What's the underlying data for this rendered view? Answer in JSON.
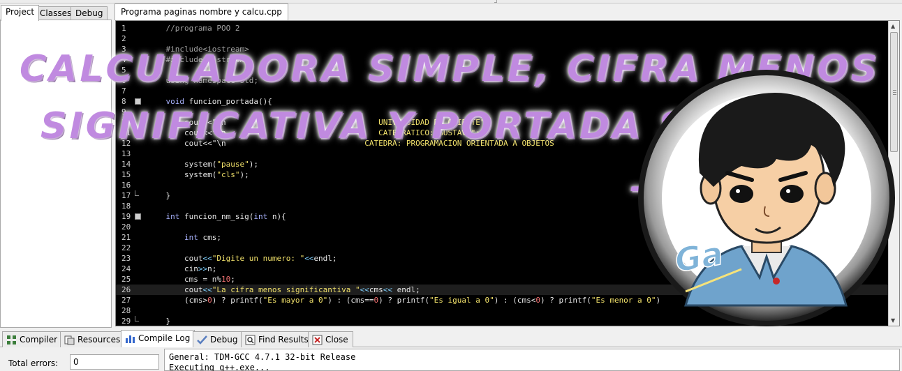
{
  "left_panel": {
    "tabs": [
      {
        "label": "Project",
        "active": true
      },
      {
        "label": "Classes",
        "active": false
      },
      {
        "label": "Debug",
        "active": false
      }
    ]
  },
  "editor": {
    "tab_label": "Programa paginas nombre y calcu.cpp",
    "lines": [
      {
        "n": "1",
        "segments": [
          {
            "t": "    //programa POO 2",
            "c": "comment"
          }
        ]
      },
      {
        "n": "2",
        "segments": []
      },
      {
        "n": "3",
        "segments": [
          {
            "t": "    #include<iostream>",
            "c": "comment"
          }
        ]
      },
      {
        "n": "4",
        "segments": [
          {
            "t": "    #include<iostream>",
            "c": "comment"
          }
        ]
      },
      {
        "n": "5",
        "segments": []
      },
      {
        "n": "6",
        "segments": [
          {
            "t": "    using namespace std;",
            "c": "comment"
          }
        ]
      },
      {
        "n": "7",
        "segments": []
      },
      {
        "n": "8",
        "fold": "box",
        "segments": [
          {
            "t": "    ",
            "c": ""
          },
          {
            "t": "void",
            "c": "kw"
          },
          {
            "t": " funcion_portada(){",
            "c": ""
          }
        ]
      },
      {
        "n": "9",
        "segments": []
      },
      {
        "n": "10",
        "segments": [
          {
            "t": "        cout<<\"\\n",
            "c": ""
          },
          {
            "t": "                                 UNIVERSIDAD DE ORIENTE\";",
            "c": "str"
          }
        ]
      },
      {
        "n": "11",
        "segments": [
          {
            "t": "        cout<<\"\\n",
            "c": ""
          },
          {
            "t": "                                 CATEDRATICO: GUSTAVO\";",
            "c": "str"
          }
        ]
      },
      {
        "n": "12",
        "segments": [
          {
            "t": "        cout<<\"\\n",
            "c": ""
          },
          {
            "t": "                              CATEDRA: PROGRAMACION ORIENTADA A OBJETOS",
            "c": "str"
          }
        ]
      },
      {
        "n": "13",
        "segments": []
      },
      {
        "n": "14",
        "segments": [
          {
            "t": "        system(",
            "c": ""
          },
          {
            "t": "\"pause\"",
            "c": "str"
          },
          {
            "t": ");",
            "c": ""
          }
        ]
      },
      {
        "n": "15",
        "segments": [
          {
            "t": "        system(",
            "c": ""
          },
          {
            "t": "\"cls\"",
            "c": "str"
          },
          {
            "t": ");",
            "c": ""
          }
        ]
      },
      {
        "n": "16",
        "segments": []
      },
      {
        "n": "17",
        "fold": "end",
        "segments": [
          {
            "t": "    }",
            "c": ""
          }
        ]
      },
      {
        "n": "18",
        "segments": []
      },
      {
        "n": "19",
        "fold": "box",
        "segments": [
          {
            "t": "    ",
            "c": ""
          },
          {
            "t": "int",
            "c": "kw"
          },
          {
            "t": " funcion_nm_sig(",
            "c": ""
          },
          {
            "t": "int",
            "c": "kw"
          },
          {
            "t": " n){",
            "c": ""
          }
        ]
      },
      {
        "n": "20",
        "segments": []
      },
      {
        "n": "21",
        "segments": [
          {
            "t": "        ",
            "c": ""
          },
          {
            "t": "int",
            "c": "kw"
          },
          {
            "t": " cms;",
            "c": ""
          }
        ]
      },
      {
        "n": "22",
        "segments": []
      },
      {
        "n": "23",
        "segments": [
          {
            "t": "        cout",
            "c": ""
          },
          {
            "t": "<<",
            "c": "op"
          },
          {
            "t": "\"Digite un numero: \"",
            "c": "str"
          },
          {
            "t": "<<",
            "c": "op"
          },
          {
            "t": "endl;",
            "c": ""
          }
        ]
      },
      {
        "n": "24",
        "segments": [
          {
            "t": "        cin",
            "c": ""
          },
          {
            "t": ">>",
            "c": "op"
          },
          {
            "t": "n;",
            "c": ""
          }
        ]
      },
      {
        "n": "25",
        "segments": [
          {
            "t": "        cms = n%",
            "c": ""
          },
          {
            "t": "10",
            "c": "num"
          },
          {
            "t": ";",
            "c": ""
          }
        ]
      },
      {
        "n": "26",
        "hl": true,
        "segments": [
          {
            "t": "        cout",
            "c": ""
          },
          {
            "t": "<<",
            "c": "op"
          },
          {
            "t": "\"La cifra menos significantiva \"",
            "c": "str"
          },
          {
            "t": "<<",
            "c": "op"
          },
          {
            "t": "cms",
            "c": ""
          },
          {
            "t": "<<",
            "c": "op"
          },
          {
            "t": " endl;",
            "c": ""
          }
        ]
      },
      {
        "n": "27",
        "segments": [
          {
            "t": "        (cms>",
            "c": ""
          },
          {
            "t": "0",
            "c": "num"
          },
          {
            "t": ") ? printf(",
            "c": ""
          },
          {
            "t": "\"Es mayor a 0\"",
            "c": "str"
          },
          {
            "t": ") : (cms==",
            "c": ""
          },
          {
            "t": "0",
            "c": "num"
          },
          {
            "t": ") ? printf(",
            "c": ""
          },
          {
            "t": "\"Es igual a 0\"",
            "c": "str"
          },
          {
            "t": ") : (cms<",
            "c": ""
          },
          {
            "t": "0",
            "c": "num"
          },
          {
            "t": ") ? printf(",
            "c": ""
          },
          {
            "t": "\"Es menor a 0\"",
            "c": "str"
          },
          {
            "t": ")",
            "c": ""
          }
        ]
      },
      {
        "n": "28",
        "segments": []
      },
      {
        "n": "29",
        "fold": "end",
        "segments": [
          {
            "t": "    }",
            "c": ""
          }
        ]
      }
    ]
  },
  "overlay": {
    "line1": "CALCULADORA SIMPLE, CIFRA MENOS",
    "line2": "SIGNIFICATIVA Y PORTADA SIMPLE",
    "line3": "--> C++",
    "avatar_text": "Ga"
  },
  "bottom_tabs": [
    {
      "label": "Compiler",
      "icon": "grid-icon",
      "active": false
    },
    {
      "label": "Resources",
      "icon": "resources-icon",
      "active": false
    },
    {
      "label": "Compile Log",
      "icon": "bar-chart-icon",
      "active": true
    },
    {
      "label": "Debug",
      "icon": "checkmark-icon",
      "active": false
    },
    {
      "label": "Find Results",
      "icon": "find-icon",
      "active": false
    },
    {
      "label": "Close",
      "icon": "close-icon",
      "active": false
    }
  ],
  "compile": {
    "errors_label": "Total errors:",
    "errors_value": "0",
    "log_lines": [
      "General: TDM-GCC 4.7.1 32-bit Release",
      "Executing g++.exe..."
    ]
  },
  "colors": {
    "editor_bg": "#000000",
    "title_purple": "#c08ae0",
    "keyword": "#aab4ff",
    "string": "#f0e06a",
    "number": "#f07070"
  }
}
